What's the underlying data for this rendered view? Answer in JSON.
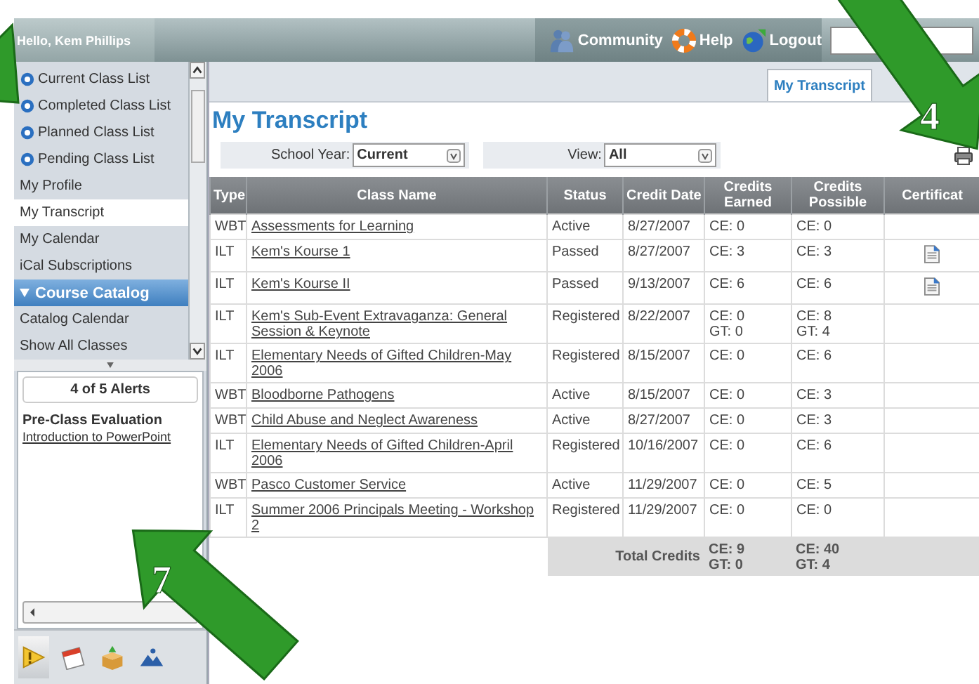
{
  "header": {
    "greeting": "Hello, Kem Phillips",
    "links": [
      {
        "label": "Community",
        "kind": "community"
      },
      {
        "label": "Help",
        "kind": "help"
      },
      {
        "label": "Logout",
        "kind": "logout"
      }
    ]
  },
  "sidebar": {
    "items": [
      {
        "label": "Current Class List",
        "kind": "list",
        "selected": false
      },
      {
        "label": "Completed Class List",
        "kind": "list",
        "selected": false
      },
      {
        "label": "Planned Class List",
        "kind": "list",
        "selected": false
      },
      {
        "label": "Pending Class List",
        "kind": "list",
        "selected": false
      },
      {
        "label": "My Profile",
        "kind": "link",
        "selected": false
      },
      {
        "label": "My Transcript",
        "kind": "link",
        "selected": true
      },
      {
        "label": "My Calendar",
        "kind": "link",
        "selected": false
      },
      {
        "label": "iCal Subscriptions",
        "kind": "link",
        "selected": false
      },
      {
        "label": "Course Catalog",
        "kind": "section",
        "selected": false,
        "expanded": true
      },
      {
        "label": "Catalog Calendar",
        "kind": "link",
        "selected": false
      },
      {
        "label": "Show All Classes",
        "kind": "link",
        "selected": false
      }
    ],
    "alerts": {
      "count": "4 of 5 Alerts",
      "title": "Pre-Class Evaluation",
      "link": "Introduction to PowerPoint"
    },
    "tools": [
      {
        "kind": "alert",
        "selected": true
      },
      {
        "kind": "calendar",
        "selected": false
      },
      {
        "kind": "box",
        "selected": false
      },
      {
        "kind": "mountains",
        "selected": false
      }
    ]
  },
  "tabs": [
    {
      "label": "My Transcript",
      "selected": true
    }
  ],
  "title": "My Transcript",
  "filters": [
    {
      "label": "School Year:",
      "value": "Current"
    },
    {
      "label": "View:",
      "value": "All"
    }
  ],
  "table": {
    "columns": [
      "Type",
      "Class Name",
      "Status",
      "Credit Date",
      "Credits Earned",
      "Credits Possible",
      "Certificat"
    ],
    "rows": [
      {
        "type": "WBT",
        "name": "Assessments for Learning",
        "status": "Active",
        "date": "8/27/2007",
        "earned": [
          "CE: 0"
        ],
        "possible": [
          "CE: 0"
        ],
        "certificate": false
      },
      {
        "type": "ILT",
        "name": "Kem's Kourse 1",
        "status": "Passed",
        "date": "8/27/2007",
        "earned": [
          "CE: 3"
        ],
        "possible": [
          "CE: 3"
        ],
        "certificate": true
      },
      {
        "type": "ILT",
        "name": "Kem's Kourse II",
        "status": "Passed",
        "date": "9/13/2007",
        "earned": [
          "CE: 6"
        ],
        "possible": [
          "CE: 6"
        ],
        "certificate": true
      },
      {
        "type": "ILT",
        "name": "Kem's Sub-Event Extravaganza: General Session & Keynote",
        "status": "Registered",
        "date": "8/22/2007",
        "earned": [
          "CE: 0",
          "GT: 0"
        ],
        "possible": [
          "CE: 8",
          "GT: 4"
        ],
        "certificate": false
      },
      {
        "type": "ILT",
        "name": "Elementary Needs of Gifted Children-May 2006",
        "status": "Registered",
        "date": "8/15/2007",
        "earned": [
          "CE: 0"
        ],
        "possible": [
          "CE: 6"
        ],
        "certificate": false
      },
      {
        "type": "WBT",
        "name": "Bloodborne Pathogens",
        "status": "Active",
        "date": "8/15/2007",
        "earned": [
          "CE: 0"
        ],
        "possible": [
          "CE: 3"
        ],
        "certificate": false
      },
      {
        "type": "WBT",
        "name": "Child Abuse and Neglect Awareness",
        "status": "Active",
        "date": "8/27/2007",
        "earned": [
          "CE: 0"
        ],
        "possible": [
          "CE: 3"
        ],
        "certificate": false
      },
      {
        "type": "ILT",
        "name": "Elementary Needs of Gifted Children-April 2006",
        "status": "Registered",
        "date": "10/16/2007",
        "earned": [
          "CE: 0"
        ],
        "possible": [
          "CE: 6"
        ],
        "certificate": false
      },
      {
        "type": "WBT",
        "name": "Pasco Customer Service",
        "status": "Active",
        "date": "11/29/2007",
        "earned": [
          "CE: 0"
        ],
        "possible": [
          "CE: 5"
        ],
        "certificate": false
      },
      {
        "type": "ILT",
        "name": "Summer 2006 Principals Meeting - Workshop 2",
        "status": "Registered",
        "date": "11/29/2007",
        "earned": [
          "CE: 0"
        ],
        "possible": [
          "CE: 0"
        ],
        "certificate": false
      }
    ],
    "totals": {
      "label": "Total Credits",
      "earned": [
        "CE: 9",
        "GT: 0"
      ],
      "possible": [
        "CE: 40",
        "GT: 4"
      ]
    }
  },
  "callouts": [
    {
      "label": "4"
    },
    {
      "label": "7"
    }
  ]
}
